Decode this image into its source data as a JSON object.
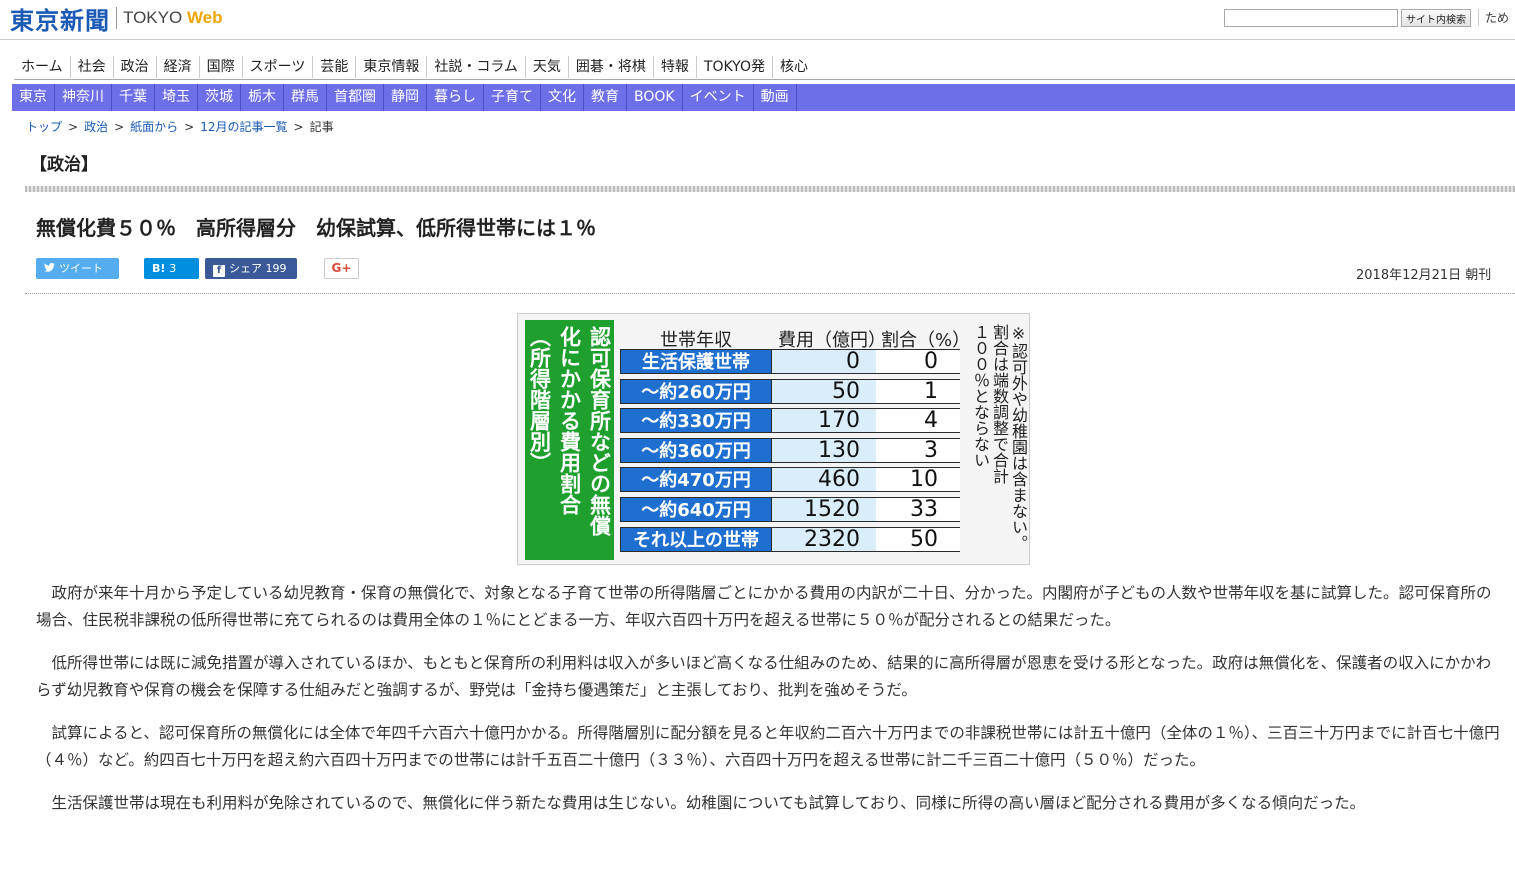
{
  "header": {
    "logo_text": "東京新聞",
    "logo_sub_plain": "TOKYO ",
    "logo_sub_accent": "Web",
    "search_button": "サイト内検索",
    "right_text": "ため"
  },
  "nav_main": [
    "ホーム",
    "社会",
    "政治",
    "経済",
    "国際",
    "スポーツ",
    "芸能",
    "東京情報",
    "社説・コラム",
    "天気",
    "囲碁・将棋",
    "特報",
    "TOKYO発",
    "核心"
  ],
  "nav_region": [
    "東京",
    "神奈川",
    "千葉",
    "埼玉",
    "茨城",
    "栃木",
    "群馬",
    "首都圏",
    "静岡",
    "暮らし",
    "子育て",
    "文化",
    "教育",
    "BOOK",
    "イベント",
    "動画"
  ],
  "breadcrumb": [
    "トップ",
    "政治",
    "紙面から",
    "12月の記事一覧",
    "記事"
  ],
  "breadcrumb_sep": ">",
  "section_label": "【政治】",
  "headline": "無償化費５０％　高所得層分　幼保試算、低所得世帯には１％",
  "social": {
    "tweet_icon": "bird-icon",
    "tweet_label": "ツイート",
    "hatena_label": "B!",
    "hatena_count": "3",
    "fb_icon": "f",
    "fb_label": "シェア",
    "fb_count": "199",
    "gplus_label": "G+"
  },
  "date": "2018年12月21日 朝刊",
  "figure": {
    "title_lines": [
      "認可保育所などの無償",
      "化にかかる費用割合",
      "（所得階層別）"
    ],
    "col_income": "世帯年収",
    "col_cost": "費用（億円）",
    "col_ratio": "割合（%）",
    "rows": [
      {
        "label": "生活保護世帯",
        "cost": "0",
        "ratio": "0"
      },
      {
        "label": "～約260万円",
        "cost": "50",
        "ratio": "1"
      },
      {
        "label": "～約330万円",
        "cost": "170",
        "ratio": "4"
      },
      {
        "label": "～約360万円",
        "cost": "130",
        "ratio": "3"
      },
      {
        "label": "～約470万円",
        "cost": "460",
        "ratio": "10"
      },
      {
        "label": "～約640万円",
        "cost": "1520",
        "ratio": "33"
      },
      {
        "label": "それ以上の世帯",
        "cost": "2320",
        "ratio": "50"
      }
    ],
    "note_lines": [
      "※認可外や幼稚園は含まない。",
      "割合は端数調整で合計",
      "１００％とならない"
    ]
  },
  "body": [
    "政府が来年十月から予定している幼児教育・保育の無償化で、対象となる子育て世帯の所得階層ごとにかかる費用の内訳が二十日、分かった。内閣府が子どもの人数や世帯年収を基に試算した。認可保育所の場合、住民税非課税の低所得世帯に充てられるのは費用全体の１％にとどまる一方、年収六百四十万円を超える世帯に５０％が配分されるとの結果だった。",
    "低所得世帯には既に減免措置が導入されているほか、もともと保育所の利用料は収入が多いほど高くなる仕組みのため、結果的に高所得層が恩恵を受ける形となった。政府は無償化を、保護者の収入にかかわらず幼児教育や保育の機会を保障する仕組みだと強調するが、野党は「金持ち優遇策だ」と主張しており、批判を強めそうだ。",
    "試算によると、認可保育所の無償化には全体で年四千六百六十億円かかる。所得階層別に配分額を見ると年収約二百六十万円までの非課税世帯には計五十億円（全体の１％）、三百三十万円までに計百七十億円（４％）など。約四百七十万円を超え約六百四十万円までの世帯には計千五百二十億円（３３％）、六百四十万円を超える世帯に計二千三百二十億円（５０％）だった。",
    "生活保護世帯は現在も利用料が免除されているので、無償化に伴う新たな費用は生じない。幼稚園についても試算しており、同様に所得の高い層ほど配分される費用が多くなる傾向だった。"
  ]
}
